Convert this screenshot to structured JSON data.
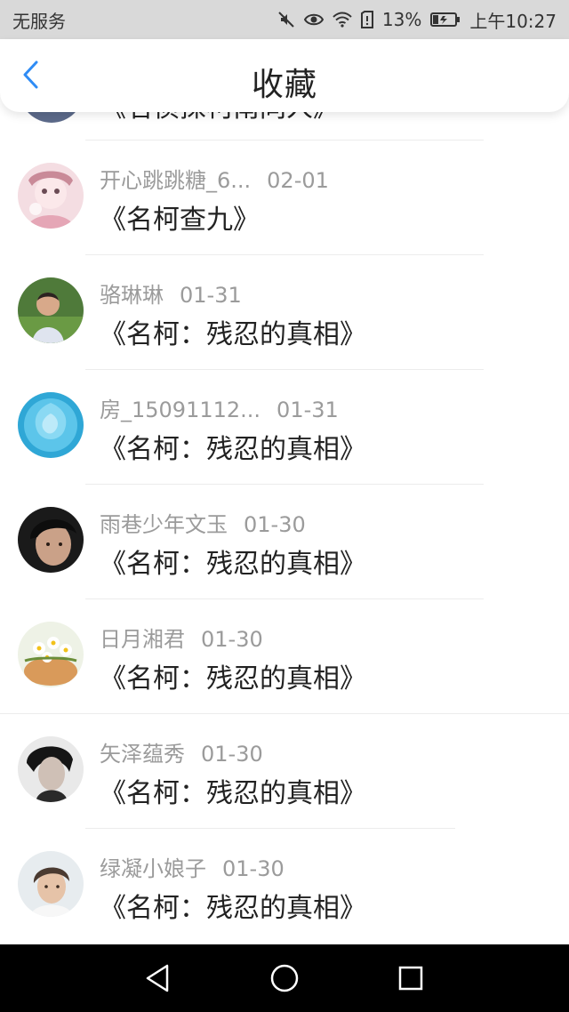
{
  "status_bar": {
    "carrier": "无服务",
    "battery_percent": "13%",
    "time": "上午10:27",
    "icons": [
      "mute-icon",
      "eye-icon",
      "wifi-icon",
      "sim-icon",
      "battery-icon"
    ]
  },
  "header": {
    "title": "收藏",
    "back_icon": "chevron-left-icon",
    "accent_color": "#2f8cf5"
  },
  "list": {
    "partial_item_title": "《名侦探柯南同人》",
    "items": [
      {
        "user": "开心跳跳糖_6...",
        "date": "02-01",
        "title": "《名柯查九》"
      },
      {
        "user": "骆琳琳",
        "date": "01-31",
        "title": "《名柯：残忍的真相》"
      },
      {
        "user": "房_15091112...",
        "date": "01-31",
        "title": "《名柯：残忍的真相》"
      },
      {
        "user": "雨巷少年文玉",
        "date": "01-30",
        "title": "《名柯：残忍的真相》"
      },
      {
        "user": "日月湘君",
        "date": "01-30",
        "title": "《名柯：残忍的真相》"
      },
      {
        "user": "矢泽蕴秀",
        "date": "01-30",
        "title": "《名柯：残忍的真相》"
      },
      {
        "user": "绿凝小娘子",
        "date": "01-30",
        "title": "《名柯：残忍的真相》"
      }
    ]
  },
  "nav_bar": {
    "buttons": [
      "back-triangle-icon",
      "home-circle-icon",
      "recents-square-icon"
    ]
  }
}
